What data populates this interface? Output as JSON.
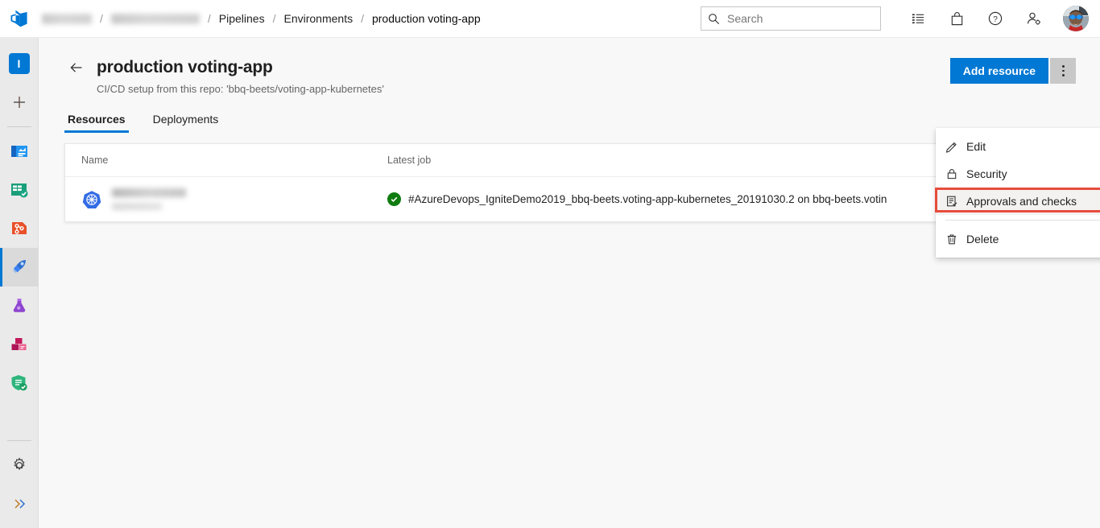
{
  "header": {
    "logo_icon": "azure-devops-logo",
    "breadcrumb": [
      {
        "label": "",
        "blurred": true,
        "width": 62
      },
      {
        "label": "",
        "blurred": true,
        "width": 110
      },
      {
        "label": "Pipelines",
        "blurred": false
      },
      {
        "label": "Environments",
        "blurred": false
      },
      {
        "label": "production voting-app",
        "blurred": false
      }
    ],
    "separator": "/",
    "search": {
      "placeholder": "Search",
      "icon": "search-icon"
    },
    "icons": [
      {
        "name": "tasks-list-icon",
        "title": "Tasks"
      },
      {
        "name": "shopping-bag-icon",
        "title": "Marketplace"
      },
      {
        "name": "help-question-icon",
        "title": "Help"
      },
      {
        "name": "user-settings-icon",
        "title": "User settings"
      }
    ],
    "avatar": {
      "name": "user-avatar",
      "title": "Account manager"
    }
  },
  "sidebar": {
    "project_avatar": {
      "label": "I",
      "color": "#0078d4"
    },
    "items": [
      {
        "name": "new-item",
        "icon": "plus-icon",
        "label": "New"
      },
      {
        "name": "overview",
        "icon": "overview-icon",
        "label": "Overview"
      },
      {
        "name": "boards",
        "icon": "boards-icon",
        "label": "Boards"
      },
      {
        "name": "repos",
        "icon": "repos-icon",
        "label": "Repos"
      },
      {
        "name": "pipelines",
        "icon": "pipelines-rocket-icon",
        "label": "Pipelines",
        "selected": true
      },
      {
        "name": "test-plans",
        "icon": "test-plans-flask-icon",
        "label": "Test Plans"
      },
      {
        "name": "artifacts",
        "icon": "artifacts-boxes-icon",
        "label": "Artifacts"
      },
      {
        "name": "advanced-security",
        "icon": "shield-check-icon",
        "label": "Advanced Security"
      }
    ],
    "bottom_items": [
      {
        "name": "project-settings",
        "icon": "gear-icon",
        "label": "Project settings"
      },
      {
        "name": "expand-rail",
        "icon": "double-chevron-right-icon",
        "label": "Expand"
      }
    ]
  },
  "page": {
    "back_label": "Back",
    "title": "production voting-app",
    "subtitle": "CI/CD setup from this repo: 'bbq-beets/voting-app-kubernetes'",
    "tabs": [
      {
        "label": "Resources",
        "active": true
      },
      {
        "label": "Deployments",
        "active": false
      }
    ],
    "add_resource_label": "Add resource",
    "more_actions_label": "More actions"
  },
  "table": {
    "columns": [
      "Name",
      "Latest job"
    ],
    "rows": [
      {
        "icon": "kubernetes-icon",
        "name": "",
        "name_blurred": true,
        "status": "succeeded",
        "latest_job": "#AzureDevops_IgniteDemo2019_bbq-beets.voting-app-kubernetes_20191030.2 on bbq-beets.votin"
      }
    ]
  },
  "context_menu": {
    "items": [
      {
        "label": "Edit",
        "icon": "pencil-icon",
        "highlighted": false
      },
      {
        "label": "Security",
        "icon": "lock-icon",
        "highlighted": false
      },
      {
        "label": "Approvals and checks",
        "icon": "clipboard-check-icon",
        "highlighted": true
      },
      {
        "label": "Delete",
        "icon": "trash-icon",
        "highlighted": false
      }
    ],
    "annotation_color": "#e74c3c"
  },
  "colors": {
    "accent": "#0078d4",
    "success": "#107c10",
    "annotation": "#e74c3c",
    "rail_bg": "#eaeaea",
    "content_bg": "#f8f8f8"
  }
}
